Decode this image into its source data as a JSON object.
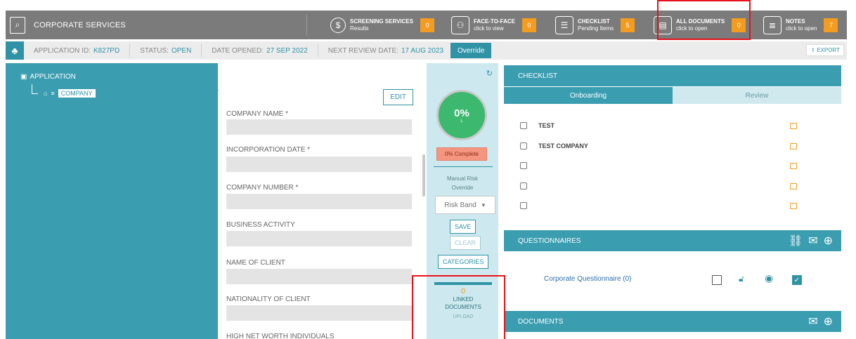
{
  "header": {
    "title": "CORPORATE SERVICES",
    "items": [
      {
        "label": "SCREENING SERVICES",
        "sub": "Results",
        "count": "0",
        "icon": "screening-icon"
      },
      {
        "label": "FACE-TO-FACE",
        "sub": "click to view",
        "count": "0",
        "icon": "face-to-face-icon"
      },
      {
        "label": "CHECKLIST",
        "sub": "Pending Items",
        "count": "5",
        "icon": "checklist-icon"
      },
      {
        "label": "ALL DOCUMENTS",
        "sub": "click to open",
        "count": "0",
        "icon": "documents-icon"
      },
      {
        "label": "NOTES",
        "sub": "click to open",
        "count": "7",
        "icon": "notes-icon"
      }
    ]
  },
  "infobar": {
    "app_label": "APPLICATION ID:",
    "app_id": "K827PD",
    "status_label": "STATUS:",
    "status": "OPEN",
    "opened_label": "DATE OPENED:",
    "opened": "27 SEP 2022",
    "review_label": "NEXT REVIEW DATE:",
    "review": "17 AUG 2023",
    "override": "Override",
    "export": "EXPORT"
  },
  "tree": {
    "root": "APPLICATION",
    "child": "COMPANY"
  },
  "form": {
    "edit": "EDIT",
    "fields": [
      "COMPANY NAME *",
      "INCORPORATION DATE *",
      "COMPANY NUMBER *",
      "BUSINESS ACTIVITY",
      "NAME OF CLIENT",
      "NATIONALITY OF CLIENT",
      "HIGH NET WORTH INDIVIDUALS"
    ]
  },
  "risk": {
    "percent": "0%",
    "level": "L",
    "complete": "0% Complete",
    "manual_line1": "Manual Risk",
    "manual_line2": "Override",
    "risk_band": "Risk Band",
    "save": "SAVE",
    "clear": "CLEAR",
    "categories": "CATEGORIES",
    "linked_count": "0",
    "linked_line1": "LINKED",
    "linked_line2": "DOCUMENTS",
    "upload": "UPLOAD"
  },
  "checklist": {
    "title": "CHECKLIST",
    "tabs": [
      "Onboarding",
      "Review"
    ],
    "items": [
      "TEST",
      "TEST COMPANY",
      "",
      "",
      ""
    ]
  },
  "questionnaires": {
    "title": "QUESTIONNAIRES",
    "item": "Corporate Questionnaire (0)"
  },
  "documents": {
    "title": "DOCUMENTS"
  },
  "colors": {
    "teal": "#3a9db0",
    "accent_orange": "#f39c1f",
    "header_grey": "#7b7b7b",
    "gauge_green": "#3cb86f"
  }
}
